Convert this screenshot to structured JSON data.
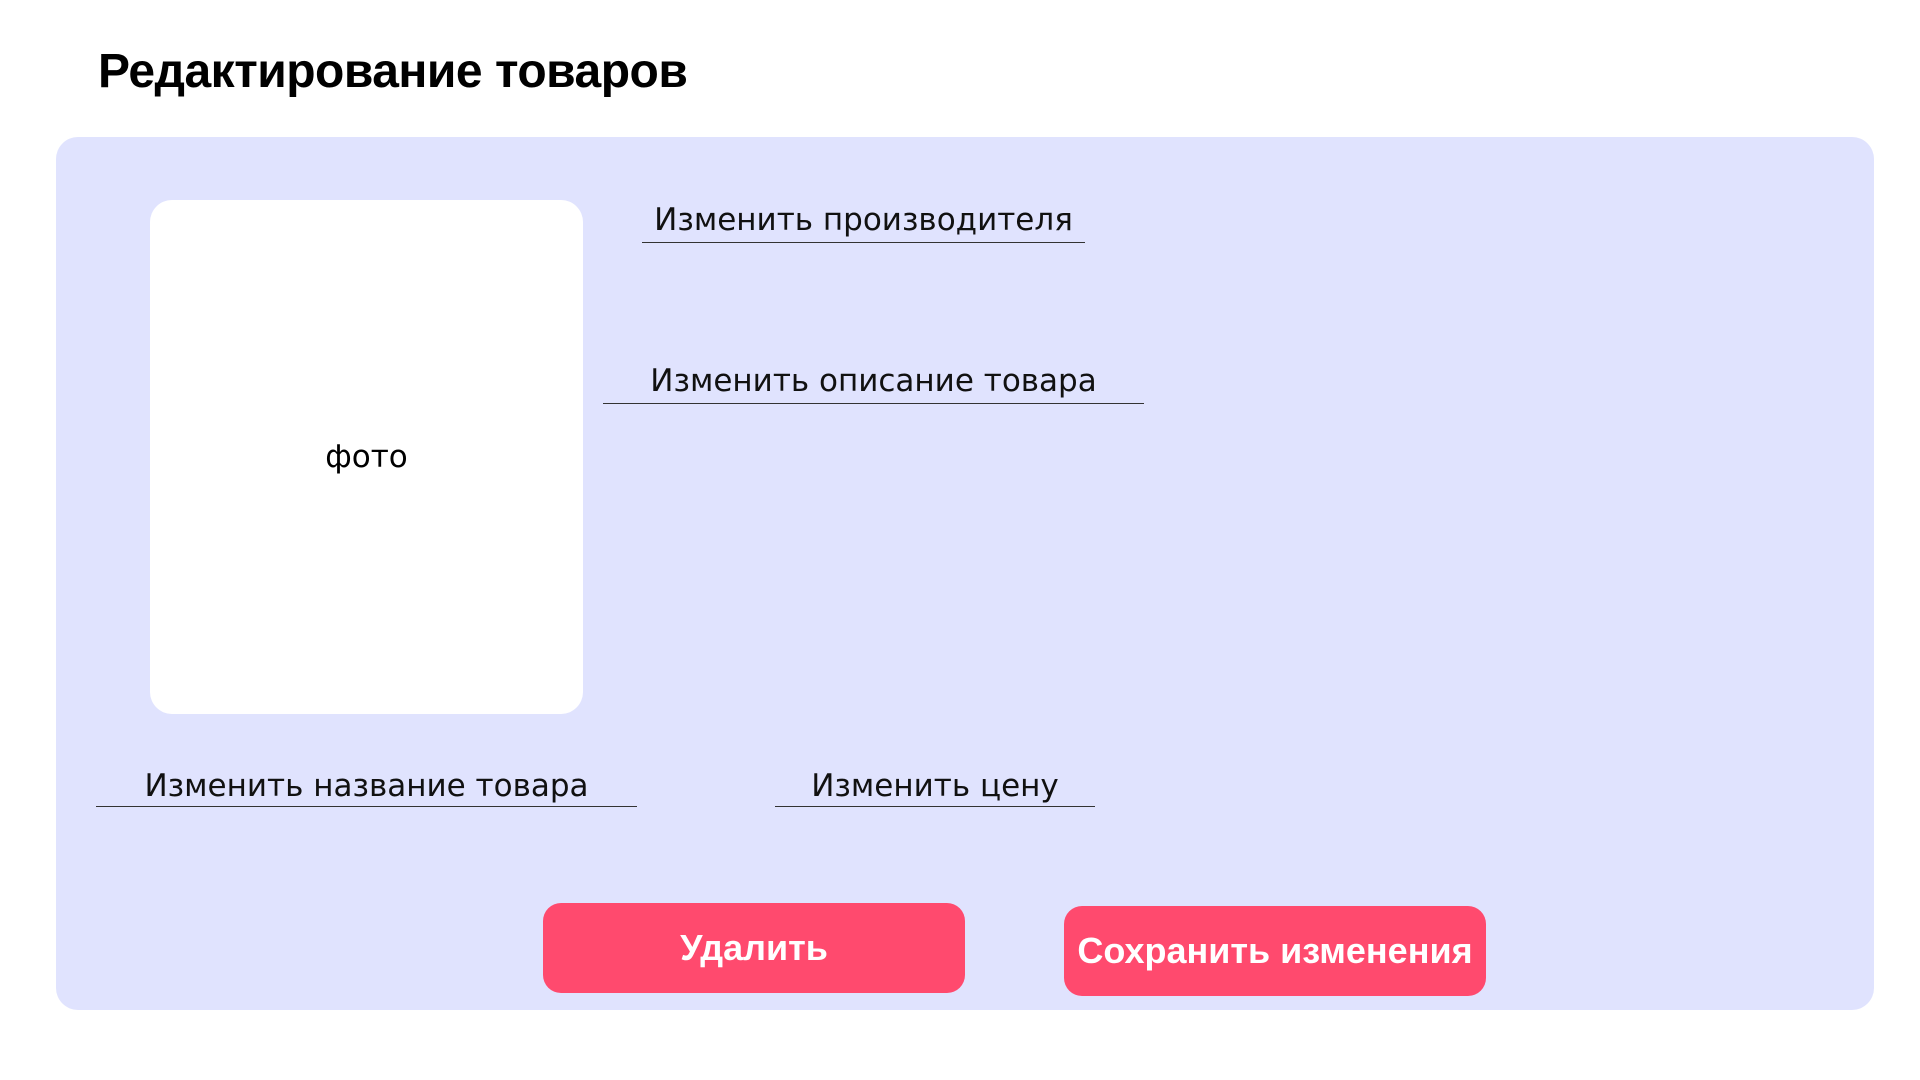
{
  "page": {
    "title": "Редактирование товаров"
  },
  "photo": {
    "label": "фото"
  },
  "fields": {
    "manufacturer": {
      "placeholder": "Изменить производителя",
      "value": ""
    },
    "description": {
      "placeholder": "Изменить описание товара",
      "value": ""
    },
    "name": {
      "placeholder": "Изменить название товара",
      "value": ""
    },
    "price": {
      "placeholder": "Изменить цену",
      "value": ""
    }
  },
  "buttons": {
    "delete_label": "Удалить",
    "save_label": "Сохранить изменения"
  },
  "colors": {
    "panel_background": "#e0e3fe",
    "button_accent": "#ff4a6e",
    "photo_background": "#ffffff"
  }
}
